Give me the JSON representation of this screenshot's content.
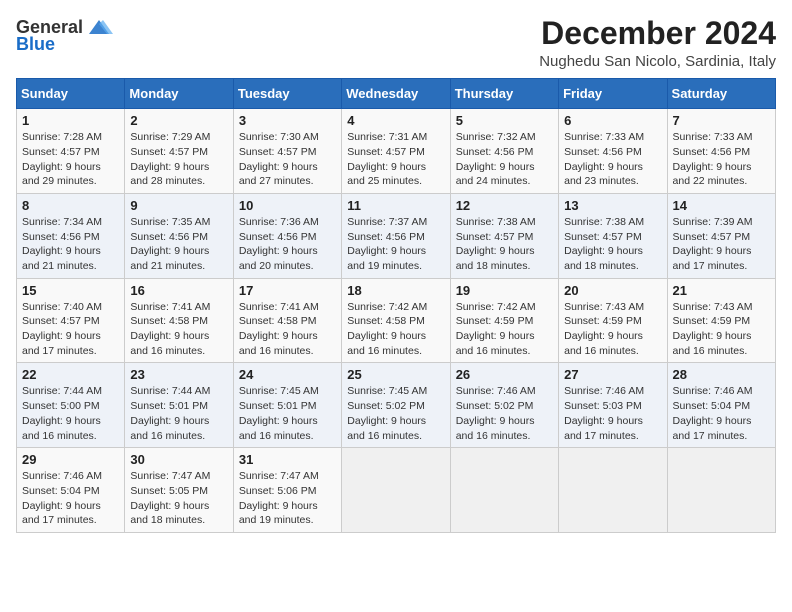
{
  "logo": {
    "general": "General",
    "blue": "Blue"
  },
  "title": "December 2024",
  "subtitle": "Nughedu San Nicolo, Sardinia, Italy",
  "weekdays": [
    "Sunday",
    "Monday",
    "Tuesday",
    "Wednesday",
    "Thursday",
    "Friday",
    "Saturday"
  ],
  "weeks": [
    [
      {
        "day": "1",
        "rise": "Sunrise: 7:28 AM",
        "set": "Sunset: 4:57 PM",
        "daylight": "Daylight: 9 hours and 29 minutes."
      },
      {
        "day": "2",
        "rise": "Sunrise: 7:29 AM",
        "set": "Sunset: 4:57 PM",
        "daylight": "Daylight: 9 hours and 28 minutes."
      },
      {
        "day": "3",
        "rise": "Sunrise: 7:30 AM",
        "set": "Sunset: 4:57 PM",
        "daylight": "Daylight: 9 hours and 27 minutes."
      },
      {
        "day": "4",
        "rise": "Sunrise: 7:31 AM",
        "set": "Sunset: 4:57 PM",
        "daylight": "Daylight: 9 hours and 25 minutes."
      },
      {
        "day": "5",
        "rise": "Sunrise: 7:32 AM",
        "set": "Sunset: 4:56 PM",
        "daylight": "Daylight: 9 hours and 24 minutes."
      },
      {
        "day": "6",
        "rise": "Sunrise: 7:33 AM",
        "set": "Sunset: 4:56 PM",
        "daylight": "Daylight: 9 hours and 23 minutes."
      },
      {
        "day": "7",
        "rise": "Sunrise: 7:33 AM",
        "set": "Sunset: 4:56 PM",
        "daylight": "Daylight: 9 hours and 22 minutes."
      }
    ],
    [
      {
        "day": "8",
        "rise": "Sunrise: 7:34 AM",
        "set": "Sunset: 4:56 PM",
        "daylight": "Daylight: 9 hours and 21 minutes."
      },
      {
        "day": "9",
        "rise": "Sunrise: 7:35 AM",
        "set": "Sunset: 4:56 PM",
        "daylight": "Daylight: 9 hours and 21 minutes."
      },
      {
        "day": "10",
        "rise": "Sunrise: 7:36 AM",
        "set": "Sunset: 4:56 PM",
        "daylight": "Daylight: 9 hours and 20 minutes."
      },
      {
        "day": "11",
        "rise": "Sunrise: 7:37 AM",
        "set": "Sunset: 4:56 PM",
        "daylight": "Daylight: 9 hours and 19 minutes."
      },
      {
        "day": "12",
        "rise": "Sunrise: 7:38 AM",
        "set": "Sunset: 4:57 PM",
        "daylight": "Daylight: 9 hours and 18 minutes."
      },
      {
        "day": "13",
        "rise": "Sunrise: 7:38 AM",
        "set": "Sunset: 4:57 PM",
        "daylight": "Daylight: 9 hours and 18 minutes."
      },
      {
        "day": "14",
        "rise": "Sunrise: 7:39 AM",
        "set": "Sunset: 4:57 PM",
        "daylight": "Daylight: 9 hours and 17 minutes."
      }
    ],
    [
      {
        "day": "15",
        "rise": "Sunrise: 7:40 AM",
        "set": "Sunset: 4:57 PM",
        "daylight": "Daylight: 9 hours and 17 minutes."
      },
      {
        "day": "16",
        "rise": "Sunrise: 7:41 AM",
        "set": "Sunset: 4:58 PM",
        "daylight": "Daylight: 9 hours and 16 minutes."
      },
      {
        "day": "17",
        "rise": "Sunrise: 7:41 AM",
        "set": "Sunset: 4:58 PM",
        "daylight": "Daylight: 9 hours and 16 minutes."
      },
      {
        "day": "18",
        "rise": "Sunrise: 7:42 AM",
        "set": "Sunset: 4:58 PM",
        "daylight": "Daylight: 9 hours and 16 minutes."
      },
      {
        "day": "19",
        "rise": "Sunrise: 7:42 AM",
        "set": "Sunset: 4:59 PM",
        "daylight": "Daylight: 9 hours and 16 minutes."
      },
      {
        "day": "20",
        "rise": "Sunrise: 7:43 AM",
        "set": "Sunset: 4:59 PM",
        "daylight": "Daylight: 9 hours and 16 minutes."
      },
      {
        "day": "21",
        "rise": "Sunrise: 7:43 AM",
        "set": "Sunset: 4:59 PM",
        "daylight": "Daylight: 9 hours and 16 minutes."
      }
    ],
    [
      {
        "day": "22",
        "rise": "Sunrise: 7:44 AM",
        "set": "Sunset: 5:00 PM",
        "daylight": "Daylight: 9 hours and 16 minutes."
      },
      {
        "day": "23",
        "rise": "Sunrise: 7:44 AM",
        "set": "Sunset: 5:01 PM",
        "daylight": "Daylight: 9 hours and 16 minutes."
      },
      {
        "day": "24",
        "rise": "Sunrise: 7:45 AM",
        "set": "Sunset: 5:01 PM",
        "daylight": "Daylight: 9 hours and 16 minutes."
      },
      {
        "day": "25",
        "rise": "Sunrise: 7:45 AM",
        "set": "Sunset: 5:02 PM",
        "daylight": "Daylight: 9 hours and 16 minutes."
      },
      {
        "day": "26",
        "rise": "Sunrise: 7:46 AM",
        "set": "Sunset: 5:02 PM",
        "daylight": "Daylight: 9 hours and 16 minutes."
      },
      {
        "day": "27",
        "rise": "Sunrise: 7:46 AM",
        "set": "Sunset: 5:03 PM",
        "daylight": "Daylight: 9 hours and 17 minutes."
      },
      {
        "day": "28",
        "rise": "Sunrise: 7:46 AM",
        "set": "Sunset: 5:04 PM",
        "daylight": "Daylight: 9 hours and 17 minutes."
      }
    ],
    [
      {
        "day": "29",
        "rise": "Sunrise: 7:46 AM",
        "set": "Sunset: 5:04 PM",
        "daylight": "Daylight: 9 hours and 17 minutes."
      },
      {
        "day": "30",
        "rise": "Sunrise: 7:47 AM",
        "set": "Sunset: 5:05 PM",
        "daylight": "Daylight: 9 hours and 18 minutes."
      },
      {
        "day": "31",
        "rise": "Sunrise: 7:47 AM",
        "set": "Sunset: 5:06 PM",
        "daylight": "Daylight: 9 hours and 19 minutes."
      },
      null,
      null,
      null,
      null
    ]
  ]
}
